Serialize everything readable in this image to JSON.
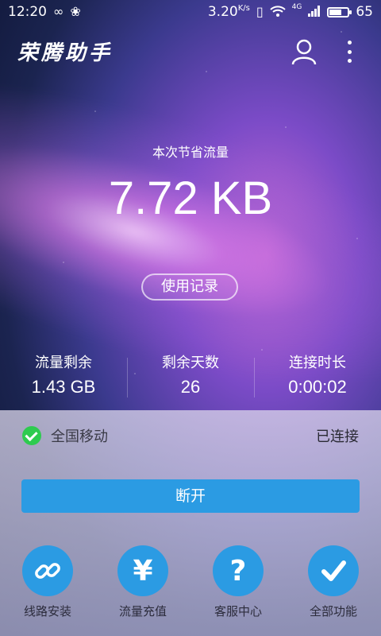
{
  "status_bar": {
    "time": "12:20",
    "speed": "3.20",
    "speed_unit": "K/s",
    "network": "4G",
    "battery": "65",
    "battery_level": 0.65
  },
  "app": {
    "title": "荣腾助手"
  },
  "saved": {
    "label": "本次节省流量",
    "value": "7.72 KB",
    "records_button": "使用记录"
  },
  "stats": [
    {
      "label": "流量剩余",
      "value": "1.43 GB"
    },
    {
      "label": "剩余天数",
      "value": "26"
    },
    {
      "label": "连接时长",
      "value": "0:00:02"
    }
  ],
  "connection": {
    "operator": "全国移动",
    "status": "已连接"
  },
  "disconnect_label": "断开",
  "features": [
    {
      "label": "线路安装",
      "icon": "link-icon"
    },
    {
      "label": "流量充值",
      "icon": "yuan-icon"
    },
    {
      "label": "客服中心",
      "icon": "question-icon"
    },
    {
      "label": "全部功能",
      "icon": "check-icon"
    }
  ],
  "colors": {
    "accent": "#2b9be3",
    "connected_green": "#2ecb4f"
  }
}
